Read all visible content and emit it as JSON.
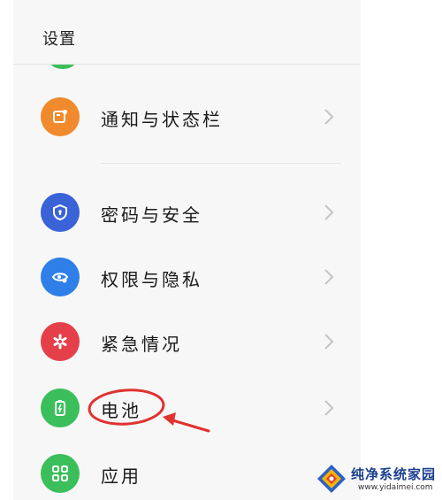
{
  "header": {
    "title": "设置"
  },
  "items": [
    {
      "label": "通知与状态栏",
      "icon": "notification-bell-icon",
      "color": "#f08a2c"
    },
    {
      "label": "密码与安全",
      "icon": "shield-icon",
      "color": "#3a63d8"
    },
    {
      "label": "权限与隐私",
      "icon": "privacy-eye-icon",
      "color": "#2f7fe8"
    },
    {
      "label": "紧急情况",
      "icon": "emergency-asterisk-icon",
      "color": "#e5404a"
    },
    {
      "label": "电池",
      "icon": "battery-icon",
      "color": "#3bbf5a"
    },
    {
      "label": "应用",
      "icon": "apps-grid-icon",
      "color": "#3bbf5a"
    }
  ],
  "annotation": {
    "color": "#e0322f"
  },
  "watermark": {
    "name": "纯净系统家园",
    "url": "www.yidaimei.com"
  }
}
